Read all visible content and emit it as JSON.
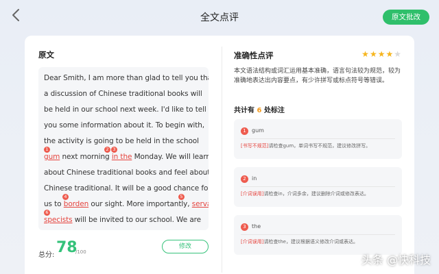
{
  "header": {
    "title": "全文点评",
    "batch_button": "原文批改"
  },
  "left": {
    "title": "原文",
    "lines": [
      {
        "parts": [
          {
            "t": "Dear Smith, I am more than glad to tell you that"
          }
        ]
      },
      {
        "parts": [
          {
            "t": "a discussion of Chinese traditional books will"
          }
        ]
      },
      {
        "parts": [
          {
            "t": "be held in our school next week. I'd like to tell"
          }
        ]
      },
      {
        "parts": [
          {
            "t": "you some information about it. To begin with,"
          }
        ]
      },
      {
        "parts": [
          {
            "t": "the activity is going to be held in the school"
          }
        ]
      },
      {
        "parts": [
          {
            "t": "gum",
            "err": true
          },
          {
            "t": " next morning "
          },
          {
            "t": "in the",
            "err": true
          },
          {
            "t": " Monday. We will learn"
          }
        ]
      },
      {
        "parts": [
          {
            "t": "about Chinese traditional books and feel about"
          }
        ]
      },
      {
        "parts": [
          {
            "t": "Chinese traditional. It will be a good chance for"
          }
        ]
      },
      {
        "parts": [
          {
            "t": "us to "
          },
          {
            "t": "borden",
            "err": true
          },
          {
            "t": " our sight. More importantly, "
          },
          {
            "t": "serval",
            "err": true
          }
        ]
      },
      {
        "parts": [
          {
            "t": "specists",
            "err": true
          },
          {
            "t": " will be invited to our school. We are"
          }
        ]
      }
    ],
    "markers": [
      "1",
      "2",
      "3",
      "4",
      "5",
      "6"
    ],
    "score_label": "总分:",
    "score": "78",
    "score_total": "/100",
    "modify_button": "修改"
  },
  "right": {
    "title": "准确性点评",
    "rating": 4,
    "rating_max": 5,
    "description": "本文语法结构或词汇运用基本准确，语言句法较为规范，较为准确地表达出内容要点，有少许拼写或标点符号等错误。",
    "count_prefix": "共计有",
    "count": "6",
    "count_suffix": "处标注",
    "issues": [
      {
        "num": "1",
        "word": "gum",
        "tag": "[书写不规范]",
        "detail": "请检查gum，单词书写不规范，建议修改拼写。"
      },
      {
        "num": "2",
        "word": "in",
        "tag": "[介词误用]",
        "detail": "请检查in，介词多余，建议删除介词或修改表达。"
      },
      {
        "num": "3",
        "word": "the",
        "tag": "[介词误用]",
        "detail": "请检查the，建议根据语义修改介词或表达。"
      }
    ]
  },
  "watermark": "头条 @快科技"
}
